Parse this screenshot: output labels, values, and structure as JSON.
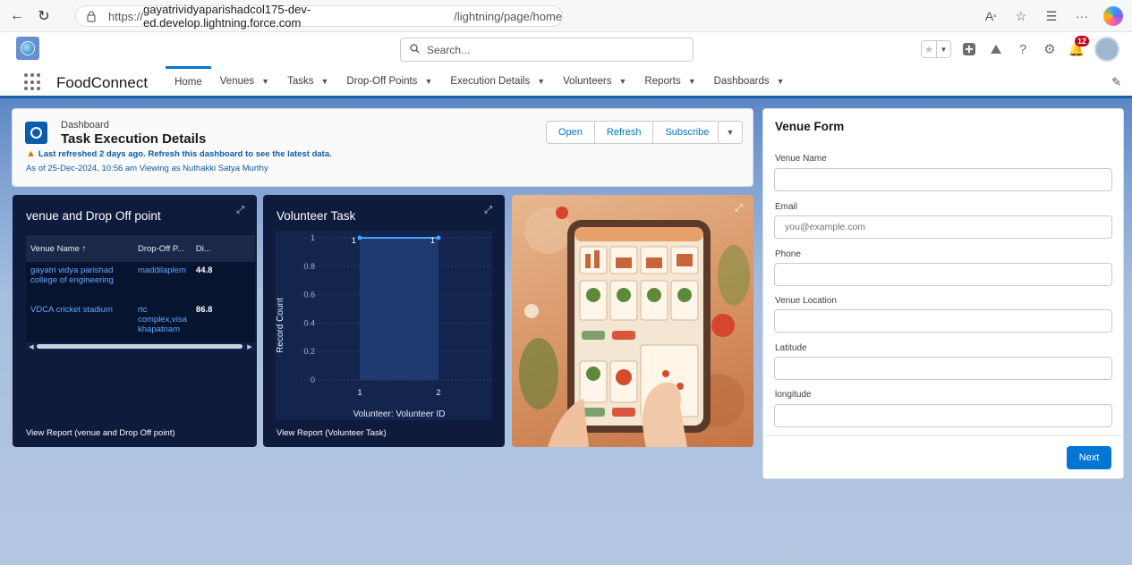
{
  "browser": {
    "url_prefix": "https://",
    "url_host": "gayatrividyaparishadcol175-dev-ed.develop.lightning.force.com",
    "url_path": "/lightning/page/home"
  },
  "header": {
    "search_placeholder": "Search...",
    "notification_count": "12"
  },
  "app": {
    "name": "FoodConnect",
    "tabs": [
      {
        "label": "Home",
        "active": true,
        "dropdown": false
      },
      {
        "label": "Venues",
        "dropdown": true
      },
      {
        "label": "Tasks",
        "dropdown": true
      },
      {
        "label": "Drop-Off Points",
        "dropdown": true
      },
      {
        "label": "Execution Details",
        "dropdown": true
      },
      {
        "label": "Volunteers",
        "dropdown": true
      },
      {
        "label": "Reports",
        "dropdown": true
      },
      {
        "label": "Dashboards",
        "dropdown": true
      }
    ]
  },
  "dashboard": {
    "label": "Dashboard",
    "title": "Task Execution Details",
    "warning": "Last refreshed 2 days ago. Refresh this dashboard to see the latest data.",
    "as_of": "As of 25-Dec-2024, 10:56 am Viewing as Nuthakki Satya Murthy",
    "buttons": {
      "open": "Open",
      "refresh": "Refresh",
      "subscribe": "Subscribe"
    }
  },
  "table_widget": {
    "title": "venue and Drop Off point",
    "columns": [
      "Venue Name ↑",
      "Drop-Off P...",
      "Di..."
    ],
    "rows": [
      {
        "venue": "gayatri vidya parishad college of engineering",
        "dropoff": "maddilaplem",
        "dist": "44.8"
      },
      {
        "venue": "VDCA cricket stadium",
        "dropoff": "rtc complex,visa khapatnam",
        "dist": "86.8"
      }
    ],
    "footer": "View Report (venue and Drop Off point)"
  },
  "chart_widget": {
    "title": "Volunteer Task",
    "footer": "View Report (Volunteer Task)"
  },
  "chart_data": {
    "type": "line",
    "x": [
      "1",
      "2"
    ],
    "series": [
      {
        "values": [
          1,
          1
        ]
      }
    ],
    "data_labels": [
      "1",
      "1"
    ],
    "xlabel": "Volunteer: Volunteer ID",
    "ylabel": "Record Count",
    "ylim": [
      0,
      1
    ],
    "yticks": [
      "0",
      "0.2",
      "0.4",
      "0.6",
      "0.8",
      "1"
    ],
    "colors": {
      "line": "#4aa3ff",
      "band": "#1e3a70",
      "bg": "#13254d"
    }
  },
  "form": {
    "title": "Venue Form",
    "fields": [
      {
        "label": "Venue Name",
        "placeholder": ""
      },
      {
        "label": "Email",
        "placeholder": "you@example.com"
      },
      {
        "label": "Phone",
        "placeholder": ""
      },
      {
        "label": "Venue Location",
        "placeholder": ""
      },
      {
        "label": "Latitude",
        "placeholder": ""
      },
      {
        "label": "longitude",
        "placeholder": ""
      }
    ],
    "next_label": "Next"
  },
  "colors": {
    "brand": "#0176d3",
    "widget_bg": "#0e1b3d",
    "warning": "#dd7a01"
  }
}
